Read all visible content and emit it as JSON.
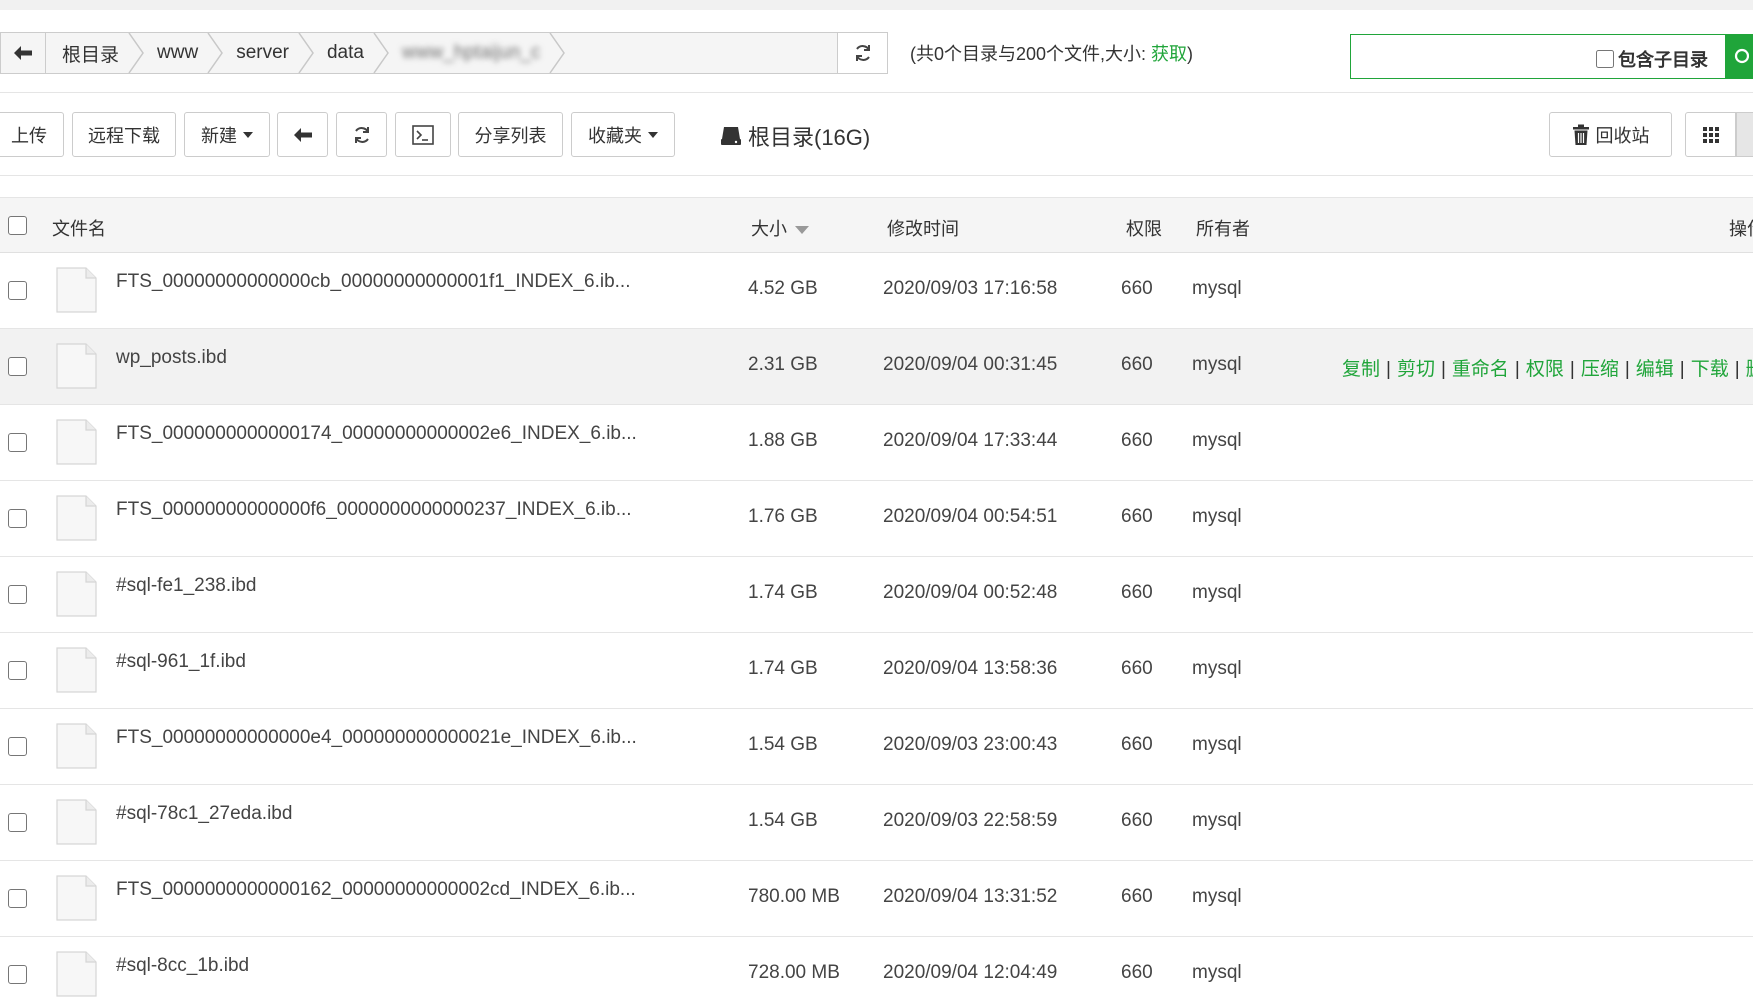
{
  "breadcrumb": {
    "items": [
      "根目录",
      "www",
      "server",
      "data",
      "www_hptaijun_c"
    ]
  },
  "summary": {
    "prefix": "(共0个目录与200个文件,大小: ",
    "link": "获取",
    "suffix": ")"
  },
  "search": {
    "placeholder": "",
    "include_subdir_label": "包含子目录"
  },
  "toolbar": {
    "upload": "上传",
    "remote_download": "远程下载",
    "new": "新建",
    "share_list": "分享列表",
    "favorites": "收藏夹",
    "disk": "根目录(16G)",
    "recycle": "回收站"
  },
  "table": {
    "headers": {
      "name": "文件名",
      "size": "大小",
      "mtime": "修改时间",
      "perm": "权限",
      "owner": "所有者",
      "ops": "操作"
    },
    "rows": [
      {
        "name": "FTS_00000000000000cb_00000000000001f1_INDEX_6.ib...",
        "size": "4.52 GB",
        "mtime": "2020/09/03 17:16:58",
        "perm": "660",
        "owner": "mysql"
      },
      {
        "name": "wp_posts.ibd",
        "size": "2.31 GB",
        "mtime": "2020/09/04 00:31:45",
        "perm": "660",
        "owner": "mysql"
      },
      {
        "name": "FTS_0000000000000174_00000000000002e6_INDEX_6.ib...",
        "size": "1.88 GB",
        "mtime": "2020/09/04 17:33:44",
        "perm": "660",
        "owner": "mysql"
      },
      {
        "name": "FTS_00000000000000f6_0000000000000237_INDEX_6.ib...",
        "size": "1.76 GB",
        "mtime": "2020/09/04 00:54:51",
        "perm": "660",
        "owner": "mysql"
      },
      {
        "name": "#sql-fe1_238.ibd",
        "size": "1.74 GB",
        "mtime": "2020/09/04 00:52:48",
        "perm": "660",
        "owner": "mysql"
      },
      {
        "name": "#sql-961_1f.ibd",
        "size": "1.74 GB",
        "mtime": "2020/09/04 13:58:36",
        "perm": "660",
        "owner": "mysql"
      },
      {
        "name": "FTS_00000000000000e4_000000000000021e_INDEX_6.ib...",
        "size": "1.54 GB",
        "mtime": "2020/09/03 23:00:43",
        "perm": "660",
        "owner": "mysql"
      },
      {
        "name": "#sql-78c1_27eda.ibd",
        "size": "1.54 GB",
        "mtime": "2020/09/03 22:58:59",
        "perm": "660",
        "owner": "mysql"
      },
      {
        "name": "FTS_0000000000000162_00000000000002cd_INDEX_6.ib...",
        "size": "780.00 MB",
        "mtime": "2020/09/04 13:31:52",
        "perm": "660",
        "owner": "mysql"
      },
      {
        "name": "#sql-8cc_1b.ibd",
        "size": "728.00 MB",
        "mtime": "2020/09/04 12:04:49",
        "perm": "660",
        "owner": "mysql"
      }
    ],
    "row_actions": [
      "复制",
      "剪切",
      "重命名",
      "权限",
      "压缩",
      "编辑",
      "下载",
      "删除"
    ]
  },
  "colors": {
    "accent": "#20a53a",
    "border": "#cccccc",
    "header_bg": "#f5f5f5",
    "hover_bg": "#f2f2f2"
  }
}
